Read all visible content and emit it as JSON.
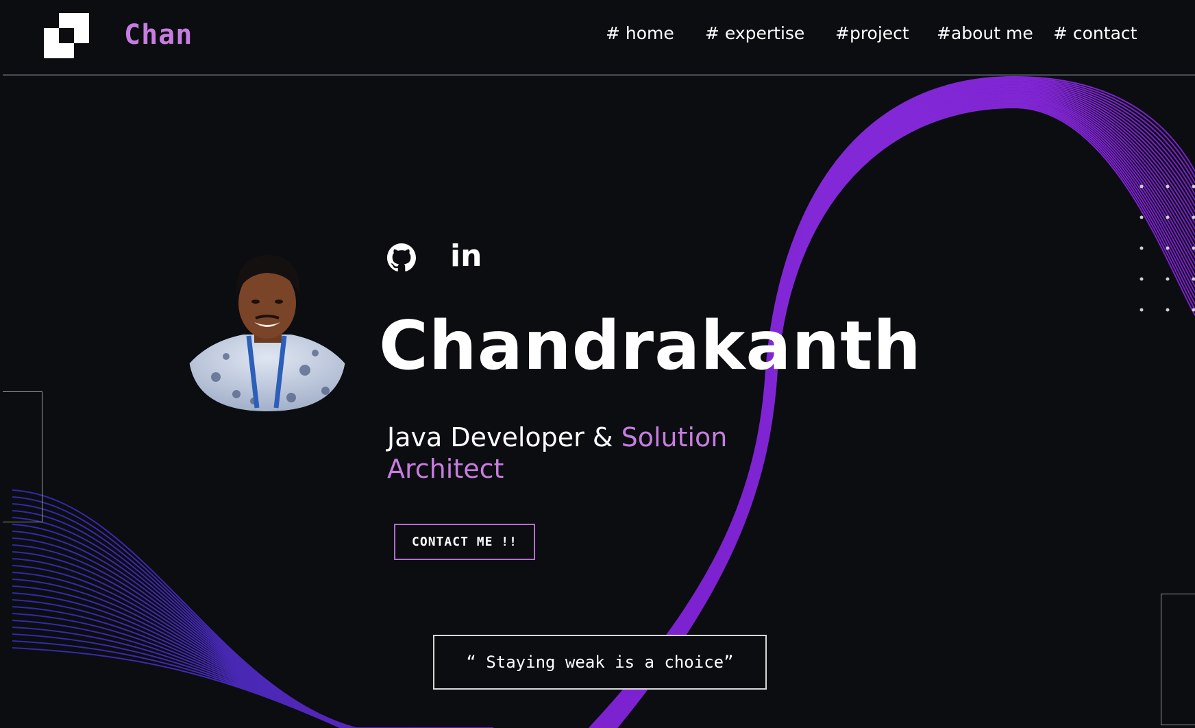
{
  "brand": {
    "logo_icon": "pixel-logo-icon",
    "name": "Chan"
  },
  "nav": {
    "items": [
      "# home",
      "# expertise",
      "#project",
      "#about me",
      "# contact"
    ]
  },
  "social": {
    "github_icon": "github-icon",
    "linkedin_label": "in"
  },
  "hero": {
    "name": "Chandrakanth",
    "role_prefix": "Java Developer & ",
    "role_accent": "Solution Architect",
    "cta_label": "CONTACT ME !!",
    "quote": "“ Staying weak is a choice”"
  },
  "colors": {
    "background": "#0b0d11",
    "accent": "#c77ddf",
    "wave_purple": "#7b1fd1",
    "wave_indigo": "#3a2fb8"
  }
}
